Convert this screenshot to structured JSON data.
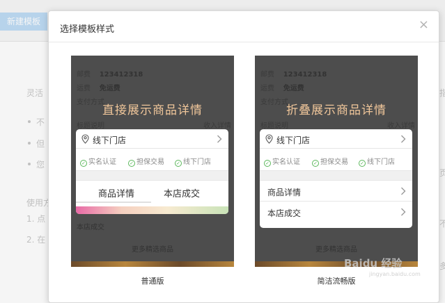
{
  "background": {
    "new_template_button": "新建模板",
    "left_texts": [
      "灵活",
      "不",
      "但",
      "您",
      "使用方",
      "1. 点",
      "2. 在"
    ],
    "right_texts": [
      "指",
      "页",
      "不",
      "多"
    ]
  },
  "modal": {
    "title": "选择模板样式",
    "close_glyph": "×"
  },
  "templates": [
    {
      "caption": "普通版",
      "background_lines": {
        "row1_label": "邮费",
        "row1_value": "123412318",
        "row2_label": "运费",
        "row2_value": "免运费",
        "row3_label": "支付方式",
        "row4_label": "标题说明",
        "row4_right": "收入详情"
      },
      "headline": "直接展示商品详情",
      "store_label": "线下门店",
      "badges": [
        "实名认证",
        "担保交易",
        "线下门店"
      ],
      "tabs": [
        "商品详情",
        "本店成交"
      ],
      "below_card": "本店成交",
      "more": "更多精选商品"
    },
    {
      "caption": "简洁流畅版",
      "background_lines": {
        "row1_label": "邮费",
        "row1_value": "123412318",
        "row2_label": "运费",
        "row2_value": "免运费",
        "row3_label": "支付方式",
        "row4_label": "标题说明",
        "row4_right": "收入详情"
      },
      "headline": "折叠展示商品详情",
      "store_label": "线下门店",
      "badges": [
        "实名认证",
        "担保交易",
        "线下门店"
      ],
      "list_items": [
        "商品详情",
        "本店成交"
      ],
      "more": "更多精选商品"
    }
  ],
  "watermark": {
    "brand": "Baidu 经验",
    "sub": "jingyan.baidu.com"
  },
  "colors": {
    "headline": "#f0c69a",
    "check": "#5cb85c",
    "preview_bg": "#4d4d4d"
  }
}
